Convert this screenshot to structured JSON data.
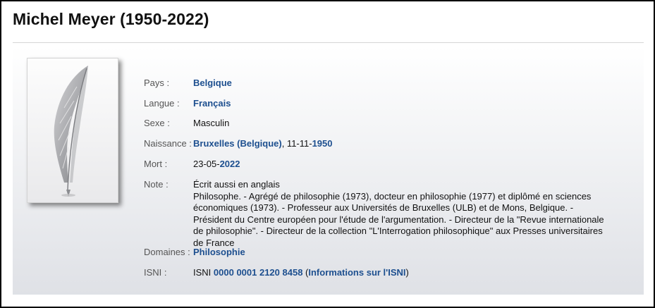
{
  "page": {
    "title": "Michel Meyer (1950-2022)"
  },
  "fields": {
    "pays": {
      "label": "Pays :",
      "value": "Belgique"
    },
    "langue": {
      "label": "Langue :",
      "value": "Français"
    },
    "sexe": {
      "label": "Sexe :",
      "value": "Masculin"
    },
    "naissance": {
      "label": "Naissance :",
      "place": "Bruxelles (Belgique)",
      "sep": ", 11-11-",
      "year": "1950"
    },
    "mort": {
      "label": "Mort :",
      "date": "23-05-",
      "year": "2022"
    },
    "note": {
      "label": "Note :",
      "line1": "Écrit aussi en anglais",
      "text": "Philosophe. - Agrégé de philosophie (1973), docteur en philosophie (1977) et diplômé en sciences économiques (1973). - Professeur aux Universités de Bruxelles (ULB) et de Mons, Belgique. - Président du Centre européen pour l'étude de l'argumentation. - Directeur de la \"Revue internationale de philosophie\". - Directeur de la collection \"L'Interrogation philosophique\" aux Presses universitaires de France"
    },
    "domaines": {
      "label": "Domaines :",
      "value": "Philosophie"
    },
    "isni": {
      "label": "ISNI :",
      "prefix": "ISNI ",
      "number": "0000 0001 2120 8458",
      "open_paren": " (",
      "info_link": "Informations sur l'ISNI",
      "close_paren": ")"
    }
  },
  "colors": {
    "link": "#1d4f8f",
    "label": "#555555"
  },
  "icons": {
    "portrait": "feather-quill-icon"
  }
}
